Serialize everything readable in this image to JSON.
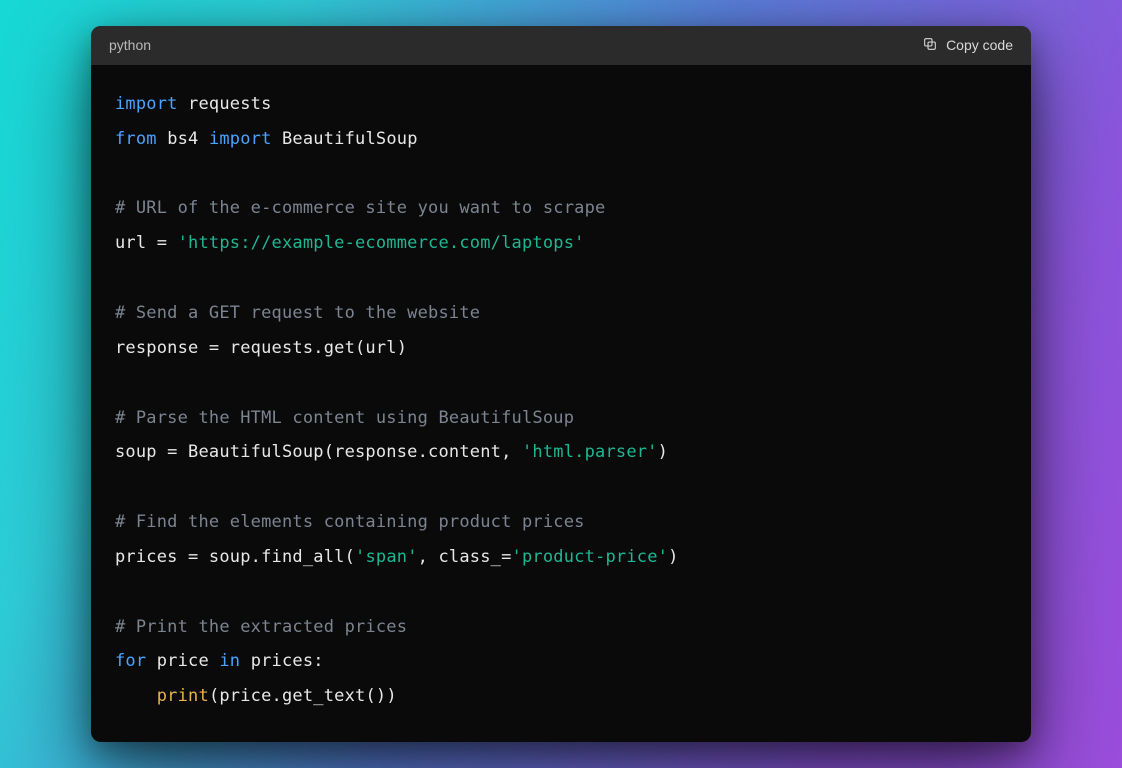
{
  "header": {
    "language": "python",
    "copy_label": "Copy code"
  },
  "code": {
    "line01_kw1": "import",
    "line01_id1": "requests",
    "line02_kw1": "from",
    "line02_id1": "bs4",
    "line02_kw2": "import",
    "line02_id2": "BeautifulSoup",
    "line04_cm": "# URL of the e-commerce site you want to scrape",
    "line05_a": "url = ",
    "line05_str": "'https://example-ecommerce.com/laptops'",
    "line07_cm": "# Send a GET request to the website",
    "line08": "response = requests.get(url)",
    "line10_cm": "# Parse the HTML content using BeautifulSoup",
    "line11_a": "soup = BeautifulSoup(response.content, ",
    "line11_str": "'html.parser'",
    "line11_b": ")",
    "line13_cm": "# Find the elements containing product prices",
    "line14_a": "prices = soup.find_all(",
    "line14_str1": "'span'",
    "line14_b": ", class_=",
    "line14_str2": "'product-price'",
    "line14_c": ")",
    "line16_cm": "# Print the extracted prices",
    "line17_kw1": "for",
    "line17_id1": "price",
    "line17_kw2": "in",
    "line17_id2": "prices:",
    "line18_indent": "    ",
    "line18_fn": "print",
    "line18_rest": "(price.get_text())"
  }
}
